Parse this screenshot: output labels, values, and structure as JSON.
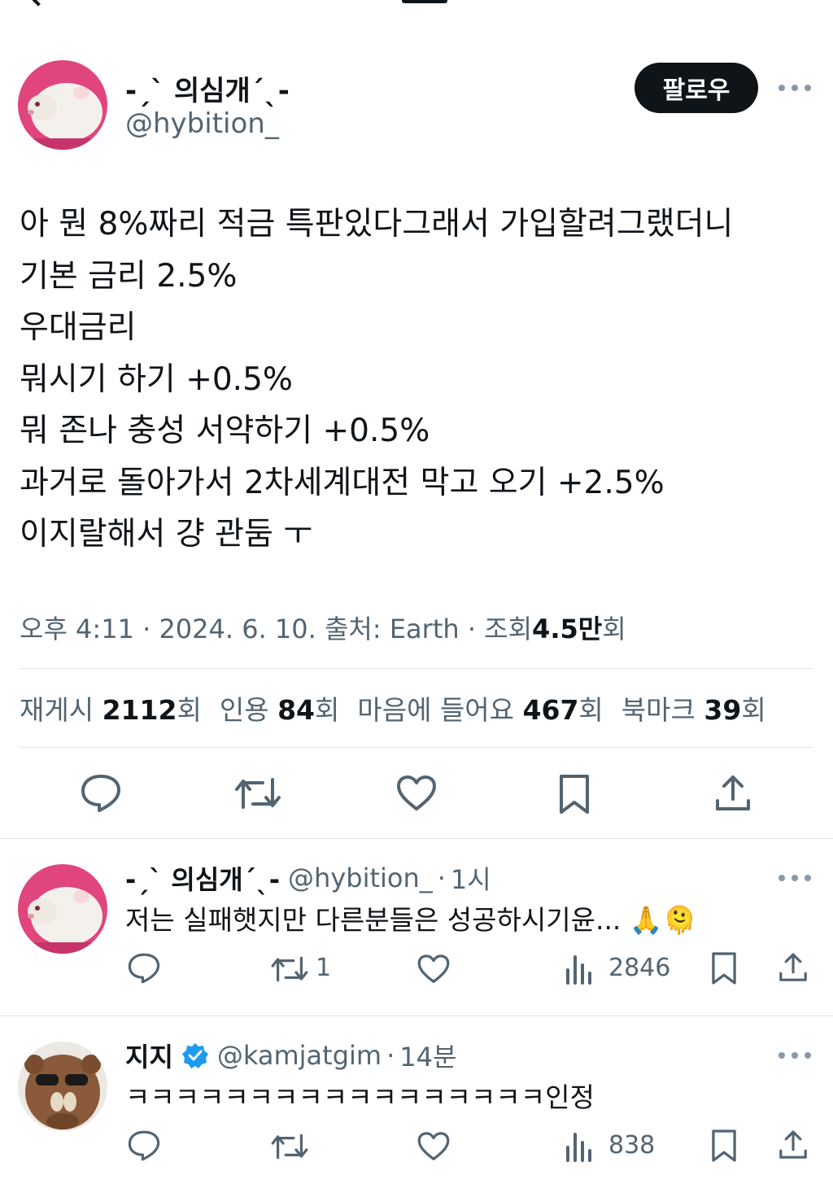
{
  "tweet": {
    "display_name": "-ˏˋ 의심개ˊˎ-",
    "handle": "@hybition_",
    "follow_label": "팔로우",
    "text_lines": [
      "아 뭔 8%짜리 적금 특판있다그래서 가입할려그랬더니",
      "기본 금리 2.5%",
      "우대금리",
      "뭐시기 하기 +0.5%",
      "뭐 존나 충성 서약하기 +0.5%",
      "과거로 돌아가서 2차세계대전 막고 오기 +2.5%",
      "이지랄해서 걍 관둠 ㅜ"
    ],
    "time": "오후 4:11",
    "date": "2024. 6. 10.",
    "source_label": "출처:",
    "source": "Earth",
    "views_label": "조회",
    "views_value": "4.5만",
    "views_unit": "회",
    "dot": "·"
  },
  "stats": {
    "reposts_label": "재게시",
    "reposts_value": "2112",
    "quotes_label": "인용",
    "quotes_value": "84",
    "likes_label": "마음에 들어요",
    "likes_value": "467",
    "bookmarks_label": "북마크",
    "bookmarks_value": "39",
    "unit": "회"
  },
  "actions": {
    "icons": [
      "reply-icon",
      "repost-icon",
      "like-icon",
      "bookmark-icon",
      "share-icon"
    ]
  },
  "replies": [
    {
      "display_name": "-ˏˋ 의심개ˊˎ-",
      "handle": "@hybition_",
      "time": "1시",
      "text": "저는 실패햇지만 다른분들은 성공하시기윤... 🙏🫠",
      "reposts": "1",
      "views": "2846",
      "verified": false
    },
    {
      "display_name": "지지",
      "handle": "@kamjatgim",
      "time": "14분",
      "text": "ㅋㅋㅋㅋㅋㅋㅋㅋㅋㅋㅋㅋㅋㅋㅋㅋㅋ인정",
      "reposts": "",
      "views": "838",
      "verified": true
    }
  ],
  "colors": {
    "text": "#0f1419",
    "secondary": "#536471",
    "verified": "#1d9bf0",
    "follow_bg": "#0f1419"
  }
}
